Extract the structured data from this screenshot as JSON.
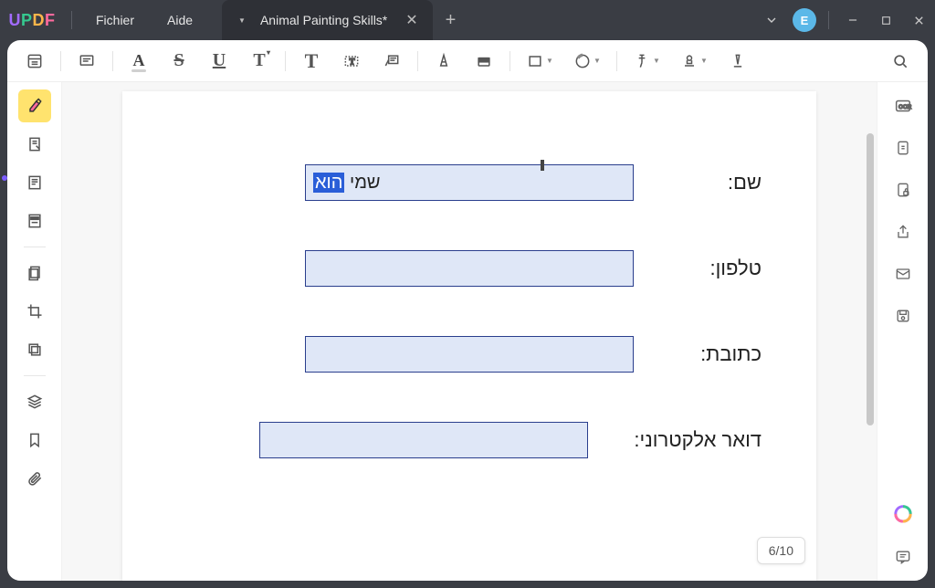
{
  "app": {
    "logo": {
      "u": "U",
      "p": "P",
      "d": "D",
      "f": "F"
    }
  },
  "menu": {
    "file": "Fichier",
    "help": "Aide"
  },
  "tab": {
    "title": "Animal Painting Skills*"
  },
  "avatar": {
    "letter": "E"
  },
  "toolbar": {
    "strike": "S",
    "underline": "U",
    "text_t1": "T",
    "text_t2": "T"
  },
  "form": {
    "name": {
      "label": "שם:",
      "value_plain": "שמי ",
      "value_selected": "הוא"
    },
    "phone": {
      "label": "טלפון:"
    },
    "address": {
      "label": "כתובת:"
    },
    "email": {
      "label": "דואר אלקטרוני:"
    }
  },
  "page_counter": "6/10"
}
